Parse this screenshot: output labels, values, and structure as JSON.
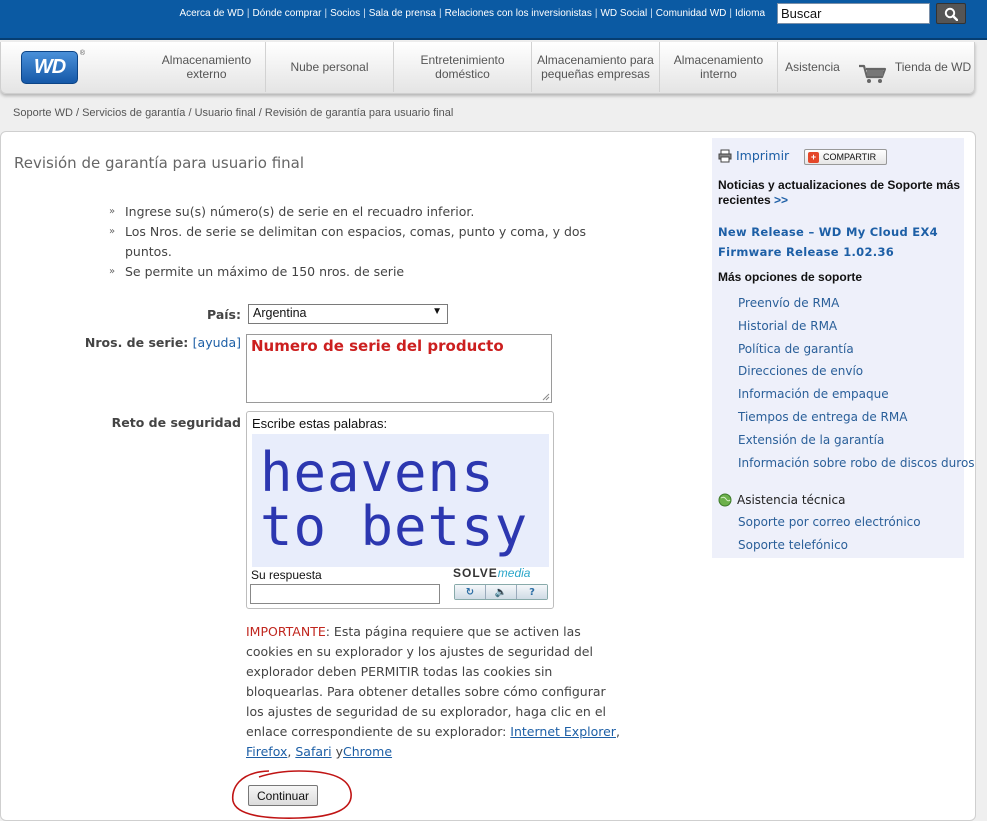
{
  "header": {
    "top_links": [
      "Acerca de WD",
      "Dónde comprar",
      "Socios",
      "Sala de prensa",
      "Relaciones con los inversionistas",
      "WD Social",
      "Comunidad WD",
      "Idioma"
    ],
    "search_value": "Buscar",
    "logo_text": "WD",
    "logo_reg": "®"
  },
  "nav": {
    "items": [
      [
        "Almacenamiento",
        "externo"
      ],
      [
        "Nube personal"
      ],
      [
        "Entretenimiento",
        "doméstico"
      ],
      [
        "Almacenamiento para",
        "pequeñas empresas"
      ],
      [
        "Almacenamiento",
        "interno"
      ],
      [
        "Asistencia"
      ],
      [
        "Tienda de WD"
      ]
    ]
  },
  "breadcrumb": [
    "Soporte WD",
    "Servicios de garantía",
    "Usuario final",
    "Revisión de garantía para usuario final"
  ],
  "main": {
    "title": "Revisión de garantía para usuario final",
    "bullets": [
      "Ingrese su(s) número(s) de serie en el recuadro inferior.",
      "Los Nros. de serie se delimitan con espacios, comas, punto y coma, y dos puntos.",
      "Se permite un máximo de 150 nros. de serie"
    ],
    "country_label": "País:",
    "country_value": "Argentina",
    "serial_label": "Nros. de serie:",
    "serial_help": "[ayuda]",
    "serial_value": "Numero de serie del producto",
    "security_label": "Reto de seguridad",
    "captcha": {
      "instruction": "Escribe estas palabras:",
      "line1": "heavens",
      "line2": "to betsy",
      "answer_label": "Su respuesta",
      "brand_a": "SOLVE",
      "brand_b": "media",
      "btn_refresh": "↻",
      "btn_audio": "🔈",
      "btn_help": "?"
    },
    "important_label": "IMPORTANTE",
    "important_text": ": Esta página requiere que se activen las cookies en su explorador y los ajustes de seguridad del explorador deben PERMITIR todas las cookies sin bloquearlas. Para obtener detalles sobre cómo configurar los ajustes de seguridad de su explorador, haga clic en el enlace correspondiente de su explorador: ",
    "link_ie": "Internet Explorer",
    "link_firefox": "Firefox",
    "link_safari": "Safari",
    "link_chrome": "Chrome",
    "sep_comma": ",",
    "sep_y": "y",
    "continue_label": "Continuar"
  },
  "sidebar": {
    "print_label": "Imprimir",
    "share_label": "COMPARTIR",
    "news_heading": "Noticias y actualizaciones de Soporte más recientes",
    "news_more": ">>",
    "release_1": "New Release – WD My Cloud EX4",
    "release_2": "Firmware Release 1.02.36",
    "more_options_heading": "Más opciones de soporte",
    "options": [
      "Preenvío de RMA",
      "Historial de RMA",
      "Política de garantía",
      "Direcciones de envío",
      "Información de empaque",
      "Tiempos de entrega de RMA",
      "Extensión de la garantía",
      "Información sobre robo de discos duros"
    ],
    "tech_label": "Asistencia técnica",
    "tech_options": [
      "Soporte por correo electrónico",
      "Soporte telefónico"
    ]
  },
  "colors": {
    "brand_blue": "#0b5aa3",
    "link_blue": "#1d5fa6",
    "important_red": "#c0261e",
    "annotation_red": "#cc1f1f"
  }
}
